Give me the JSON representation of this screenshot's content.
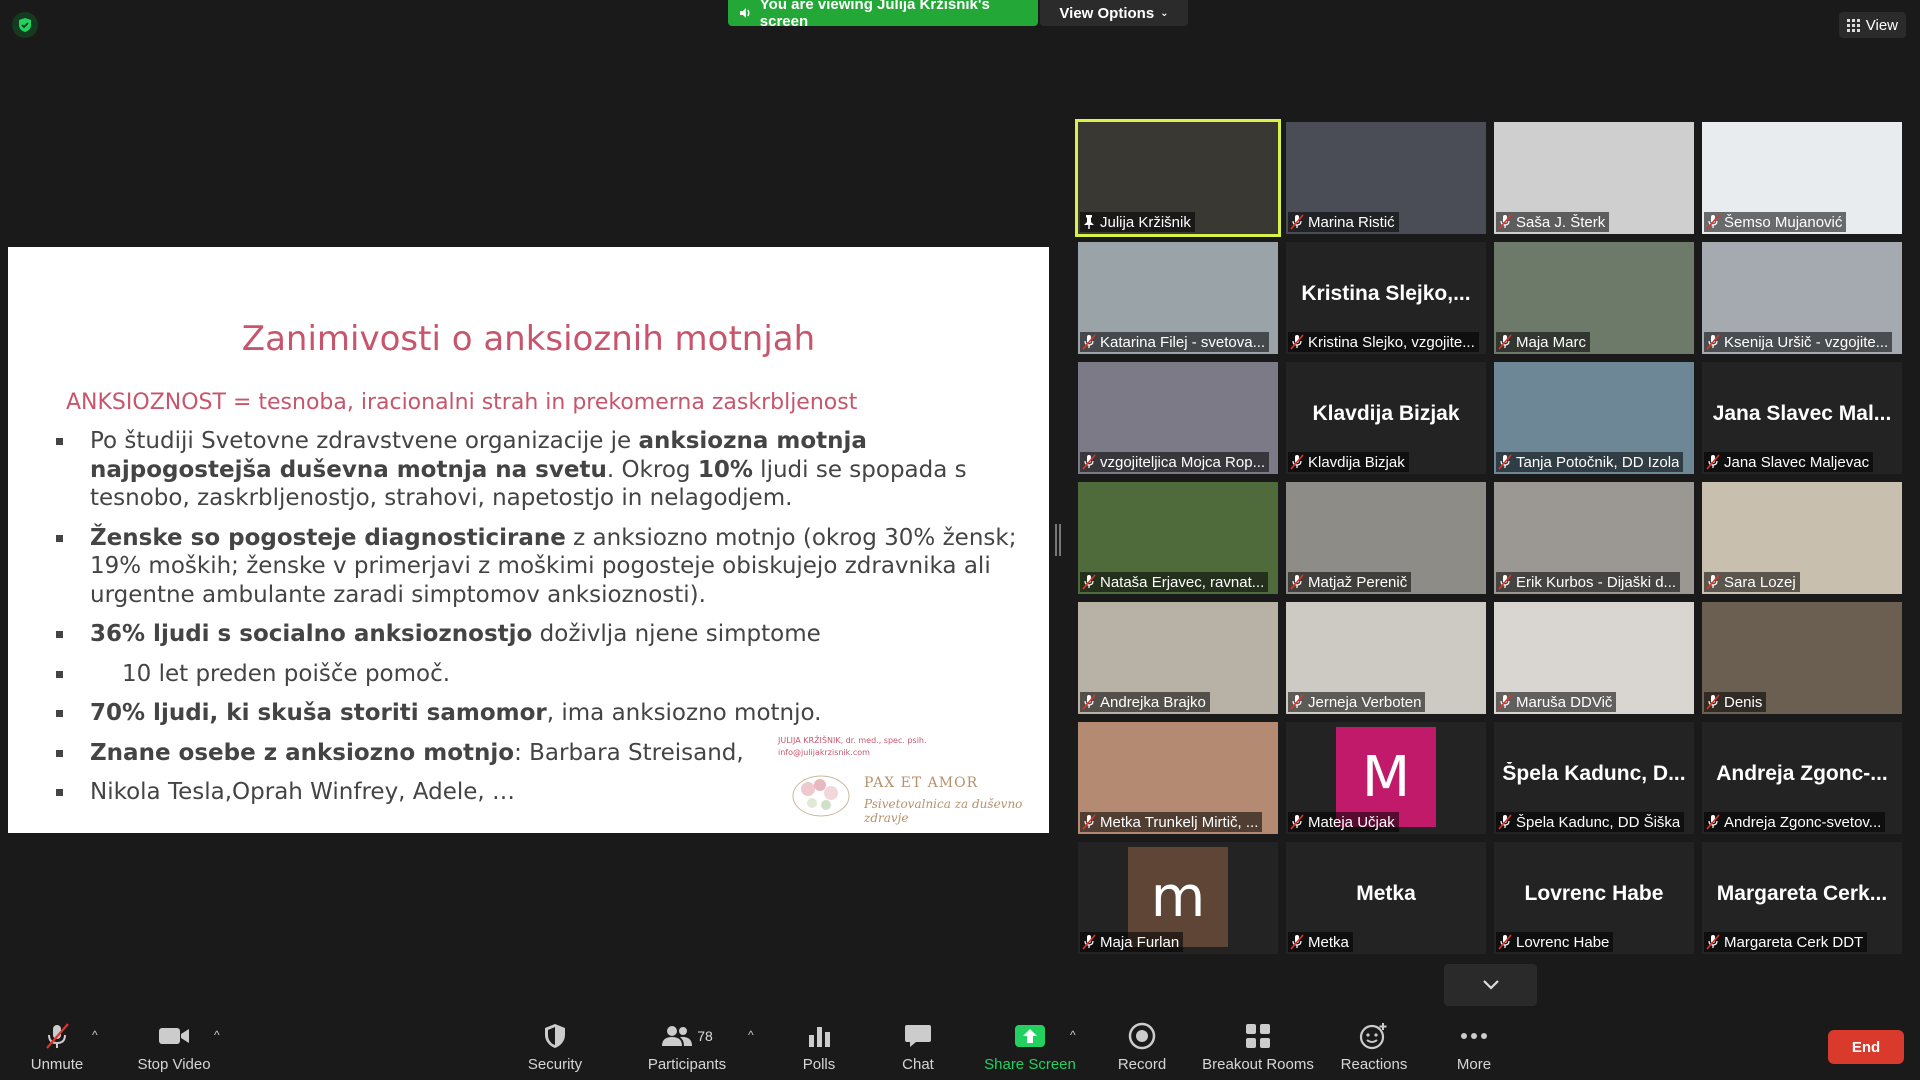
{
  "top": {
    "viewing_banner": "You are viewing Julija Kržišnik's screen",
    "view_options": "View Options",
    "view": "View"
  },
  "slide": {
    "title": "Zanimivosti o anksioznih motnjah",
    "subtitle": "ANKSIOZNOST = tesnoba, iracionalni strah in prekomerna zaskrbljenost",
    "bullets": [
      {
        "pre": "Po študiji Svetovne zdravstvene organizacije je ",
        "b1": "anksiozna motnja najpogostejša duševna motnja na svetu",
        "mid": ". Okrog ",
        "b2": "10%",
        "post": " ljudi se spopada s tesnobo, zaskrbljenostjo, strahovi, napetostjo in nelagodjem."
      },
      {
        "pre": "",
        "b1": "Ženske so pogosteje diagnosticirane",
        "mid": " z anksiozno motnjo (okrog 30% žensk; 19% moških; ženske v primerjavi z moškimi pogosteje obiskujejo zdravnika ali urgentne ambulante zaradi simptomov anksioznosti).",
        "b2": "",
        "post": ""
      },
      {
        "pre": "",
        "b1": "36% ljudi s socialno anksioznostjo",
        "mid": " doživlja njene simptome",
        "b2": "",
        "post": ""
      },
      {
        "pre": "",
        "b1": "10 let preden poišče pomoč.",
        "mid": "",
        "b2": "",
        "post": ""
      },
      {
        "pre": "",
        "b1": "70% ljudi, ki skuša storiti samomor",
        "mid": ", ima anksiozno motnjo.",
        "b2": "",
        "post": ""
      },
      {
        "pre": "",
        "b1": "Znane osebe z anksiozno motnjo",
        "mid": ": Barbara Streisand,",
        "b2": "",
        "post": ""
      },
      {
        "pre": "",
        "b1": "",
        "mid": "Nikola Tesla,Oprah Winfrey, Adele, …",
        "b2": "",
        "post": ""
      }
    ],
    "signature_line1": "JULIJA KRŽIŠNIK, dr. med., spec. psih.",
    "signature_line2": "info@julijakrzisnik.com",
    "logo_name": "PAX ET AMOR",
    "logo_sub": "Psivetovalnica za duševno zdravje"
  },
  "participants": [
    {
      "name": "Julija Kržišnik",
      "center": "",
      "avatar": "",
      "pinned": true
    },
    {
      "name": "Marina Ristić",
      "center": "",
      "avatar": ""
    },
    {
      "name": "Saša J. Šterk",
      "center": "",
      "avatar": ""
    },
    {
      "name": "Šemso Mujanović",
      "center": "",
      "avatar": ""
    },
    {
      "name": "Katarina Filej - svetova...",
      "center": "",
      "avatar": ""
    },
    {
      "name": "Kristina Slejko, vzgojite...",
      "center": "Kristina Slejko,...",
      "avatar": ""
    },
    {
      "name": "Maja Marc",
      "center": "",
      "avatar": ""
    },
    {
      "name": "Ksenija Uršič - vzgojite...",
      "center": "",
      "avatar": ""
    },
    {
      "name": "vzgojiteljica Mojca Rop...",
      "center": "",
      "avatar": ""
    },
    {
      "name": "Klavdija Bizjak",
      "center": "Klavdija Bizjak",
      "avatar": ""
    },
    {
      "name": "Tanja Potočnik, DD Izola",
      "center": "",
      "avatar": ""
    },
    {
      "name": "Jana Slavec Maljevac",
      "center": "Jana Slavec Mal...",
      "avatar": ""
    },
    {
      "name": "Nataša Erjavec, ravnat...",
      "center": "",
      "avatar": ""
    },
    {
      "name": "Matjaž Perenič",
      "center": "",
      "avatar": ""
    },
    {
      "name": "Erik Kurbos - Dijaški d...",
      "center": "",
      "avatar": ""
    },
    {
      "name": "Sara Lozej",
      "center": "",
      "avatar": ""
    },
    {
      "name": "Andrejka Brajko",
      "center": "",
      "avatar": ""
    },
    {
      "name": "Jerneja Verboten",
      "center": "",
      "avatar": ""
    },
    {
      "name": "Maruša DDVič",
      "center": "",
      "avatar": ""
    },
    {
      "name": "Denis",
      "center": "",
      "avatar": ""
    },
    {
      "name": "Metka Trunkelj Mirtič, ...",
      "center": "",
      "avatar": ""
    },
    {
      "name": "Mateja Učjak",
      "center": "",
      "avatar": "M"
    },
    {
      "name": "Špela Kadunc, DD Šiška",
      "center": "Špela Kadunc, D...",
      "avatar": ""
    },
    {
      "name": "Andreja Zgonc-svetov...",
      "center": "Andreja Zgonc-...",
      "avatar": ""
    },
    {
      "name": "Maja Furlan",
      "center": "",
      "avatar": "m"
    },
    {
      "name": "Metka",
      "center": "Metka",
      "avatar": ""
    },
    {
      "name": "Lovrenc Habe",
      "center": "Lovrenc Habe",
      "avatar": ""
    },
    {
      "name": "Margareta Cerk DDT",
      "center": "Margareta Cerk...",
      "avatar": ""
    }
  ],
  "toolbar": {
    "unmute": "Unmute",
    "stop_video": "Stop Video",
    "security": "Security",
    "participants": "Participants",
    "participant_count": "78",
    "polls": "Polls",
    "chat": "Chat",
    "share_screen": "Share Screen",
    "record": "Record",
    "breakout_rooms": "Breakout Rooms",
    "reactions": "Reactions",
    "more": "More",
    "end": "End"
  },
  "colors": {
    "accent_green": "#23a838",
    "slide_title": "#c7566d",
    "active_speaker": "#d8f24a",
    "end_red": "#d93a2b"
  }
}
